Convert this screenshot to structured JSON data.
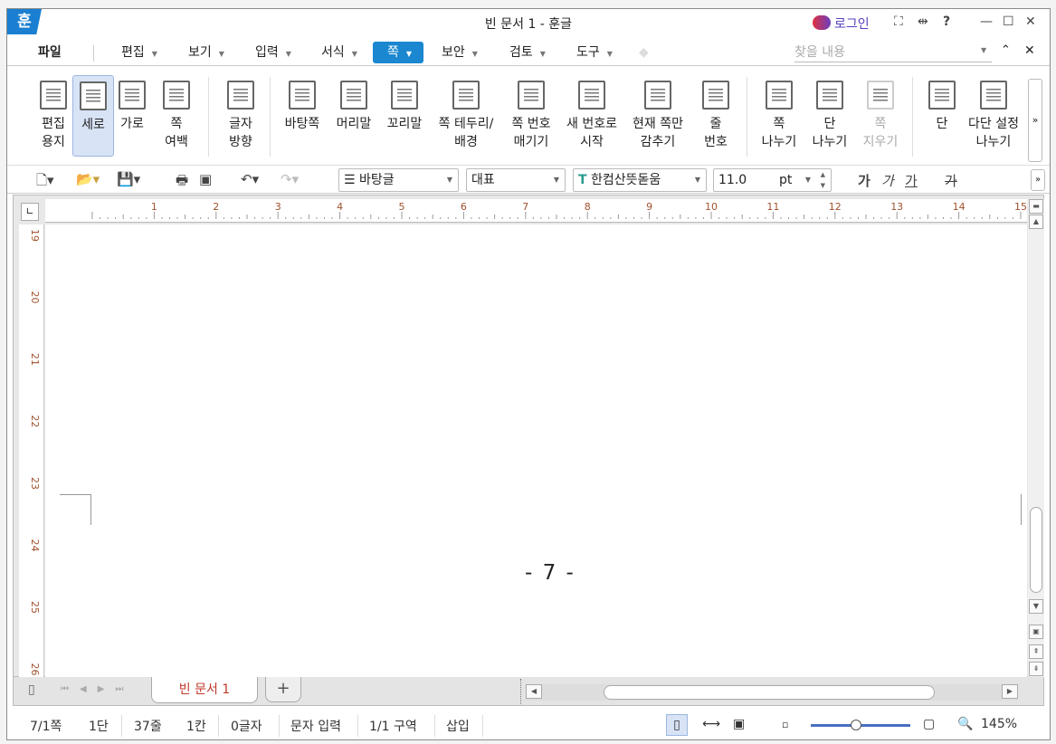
{
  "window": {
    "title": "빈 문서 1 - 훈글",
    "logo": "훈",
    "login": "로그인"
  },
  "menu": {
    "items": [
      "파일",
      "편집",
      "보기",
      "입력",
      "서식",
      "쪽",
      "보안",
      "검토",
      "도구"
    ],
    "active": "쪽",
    "search_placeholder": "찾을 내용"
  },
  "ribbon": [
    {
      "l1": "편집",
      "l2": "용지"
    },
    {
      "l1": "세로",
      "l2": "",
      "selected": true
    },
    {
      "l1": "가로",
      "l2": ""
    },
    {
      "l1": "쪽",
      "l2": "여백"
    },
    {
      "l1": "글자",
      "l2": "방향"
    },
    {
      "l1": "바탕쪽",
      "l2": ""
    },
    {
      "l1": "머리말",
      "l2": ""
    },
    {
      "l1": "꼬리말",
      "l2": ""
    },
    {
      "l1": "쪽 테두리/",
      "l2": "배경"
    },
    {
      "l1": "쪽 번호",
      "l2": "매기기"
    },
    {
      "l1": "새 번호로",
      "l2": "시작"
    },
    {
      "l1": "현재 쪽만",
      "l2": "감추기"
    },
    {
      "l1": "줄",
      "l2": "번호"
    },
    {
      "l1": "쪽",
      "l2": "나누기"
    },
    {
      "l1": "단",
      "l2": "나누기"
    },
    {
      "l1": "쪽",
      "l2": "지우기",
      "disabled": true
    },
    {
      "l1": "단",
      "l2": ""
    },
    {
      "l1": "다단 설정",
      "l2": "나누기"
    }
  ],
  "toolbar": {
    "style": "바탕글",
    "outline": "대표",
    "font": "한컴산뜻돋움",
    "size": "11.0",
    "unit": "pt",
    "fmt": [
      "가",
      "가",
      "가",
      "가"
    ]
  },
  "ruler": {
    "h": [
      "1",
      "2",
      "3",
      "4",
      "5",
      "6",
      "7",
      "8",
      "9",
      "10",
      "11",
      "12",
      "13",
      "14",
      "15"
    ],
    "v": [
      "19",
      "20",
      "21",
      "22",
      "23",
      "24",
      "25",
      "26"
    ]
  },
  "page": {
    "number": "- 7 -"
  },
  "tabs": {
    "doc": "빈 문서 1",
    "add": "+"
  },
  "status": {
    "page": "7/1쪽",
    "col": "1단",
    "line": "37줄",
    "cell": "1칸",
    "chars": "0글자",
    "mode": "문자 입력",
    "section": "1/1 구역",
    "insert": "삽입",
    "zoom": "145%",
    "zoom_fraction": 0.45
  }
}
